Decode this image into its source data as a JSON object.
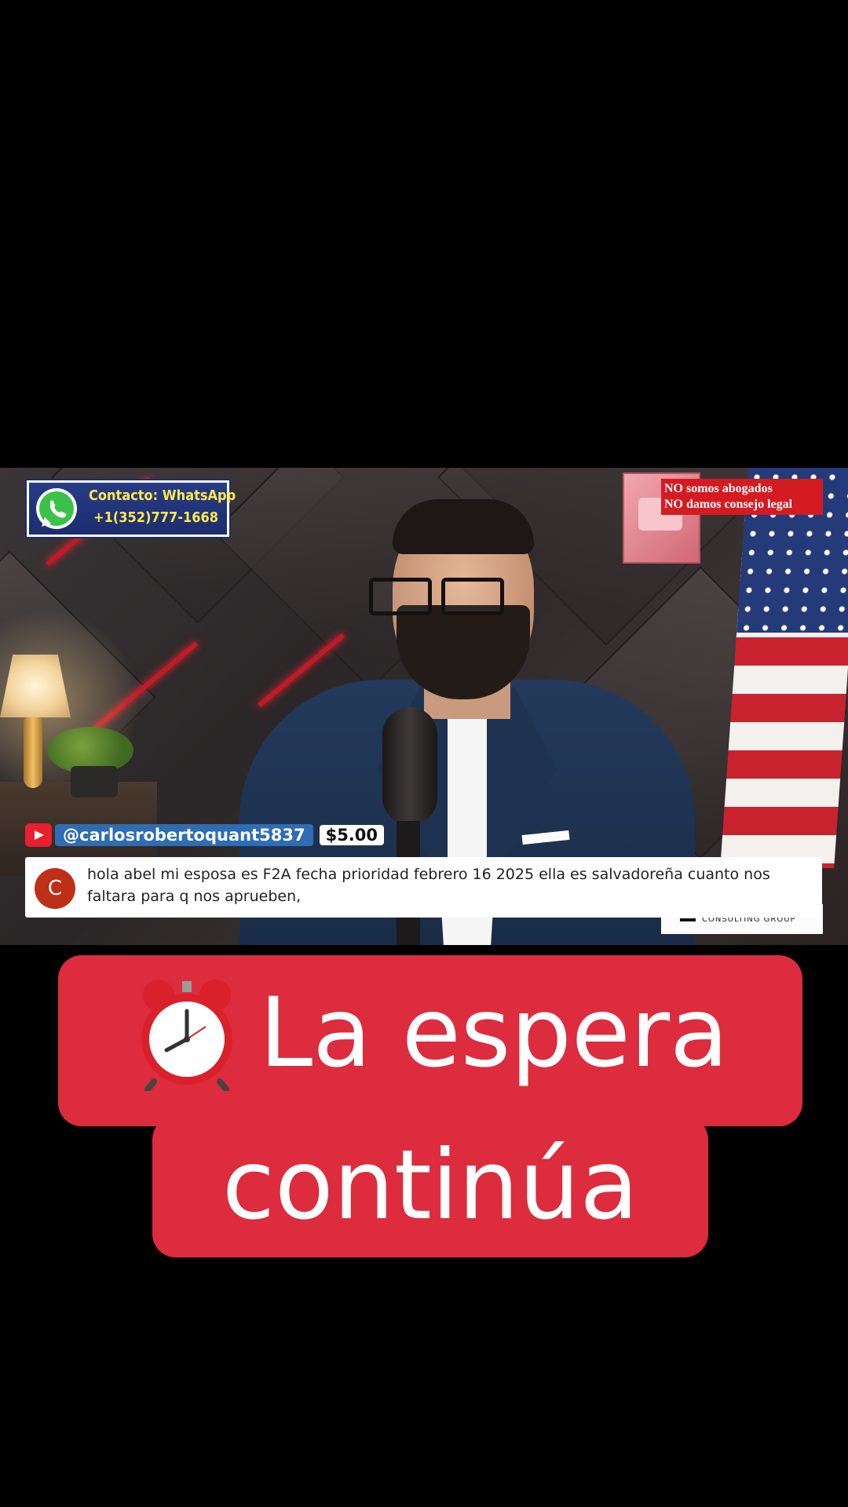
{
  "overlay": {
    "whatsapp_title": "Contacto: WhatsApp",
    "whatsapp_phone": "+1(352)777-1668",
    "disclaimer_line1": "NO somos abogados",
    "disclaimer_line2": "NO damos consejo legal",
    "logo_text": "CONSULTING GROUP"
  },
  "chat": {
    "platform_icon": "youtube-icon",
    "username": "@carlosrobertoquant5837",
    "amount": "$5.00",
    "avatar_letter": "C",
    "message": "hola abel mi esposa es F2A fecha prioridad febrero 16 2025 ella es salvadoreña cuanto nos faltara para q nos aprueben,"
  },
  "caption": {
    "icon": "alarm-clock-icon",
    "line1": "La espera",
    "line2": "continúa"
  },
  "colors": {
    "caption_bg": "#dc2c3d",
    "chat_user_chip": "#2e6db3",
    "disclaimer_bg": "#d41b21",
    "whatsapp_text": "#ffe84a"
  }
}
